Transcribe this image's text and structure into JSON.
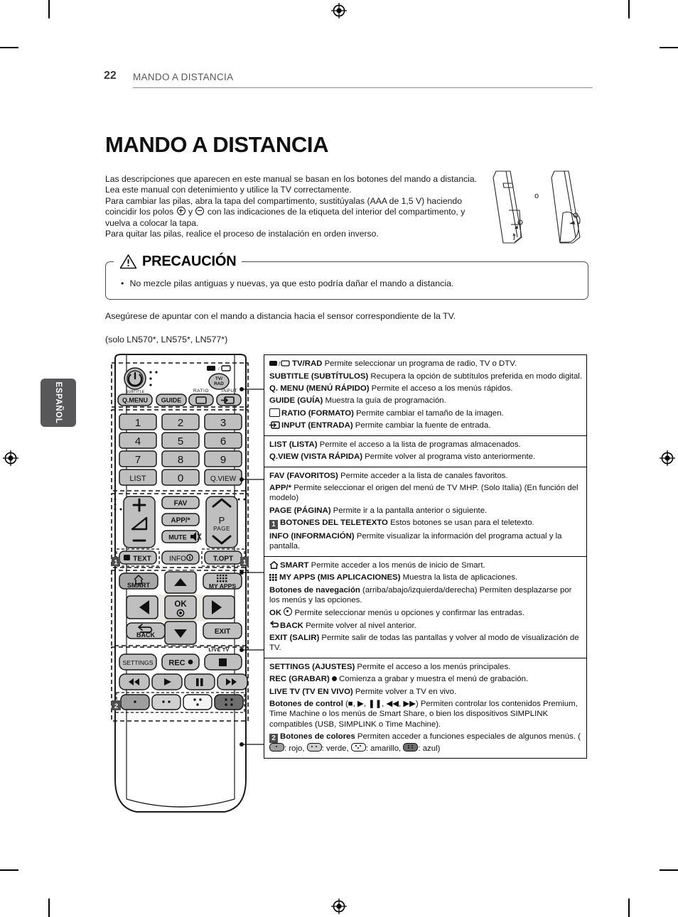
{
  "page": {
    "number": "22",
    "section": "MANDO A DISTANCIA",
    "title": "MANDO A DISTANCIA",
    "language_tab": "ESPAÑOL"
  },
  "intro": {
    "line1": "Las descripciones que aparecen en este manual se basan en los botones del mando a distancia.",
    "line2": "Lea este manual con detenimiento y utilice la TV correctamente.",
    "line3_a": "Para cambiar las pilas, abra la tapa del compartimento, sustitúyalas (AAA de 1,5 V) haciendo coincidir los polos",
    "line3_b": "y",
    "line3_c": "con las indicaciones de la etiqueta del interior del compartimento, y vuelva a colocar la tapa.",
    "line4": "Para quitar las pilas, realice el proceso de instalación en orden inverso."
  },
  "battery_illustration": {
    "separator_label": "o"
  },
  "caution": {
    "heading": "PRECAUCIÓN",
    "bullet": "•",
    "item": "No mezcle pilas antiguas y nuevas, ya que esto podría dañar el mando a distancia."
  },
  "aim_note": "Asegúrese de apuntar con el mando a distancia hacia el sensor correspondiente de la TV.",
  "model_line": "(solo  LN570*, LN575*, LN577*)",
  "remote": {
    "buttons": {
      "power": "power-icon",
      "tv_rad": "TV/\nRAD",
      "subtitle_label": "SUBTITLE",
      "q_menu": "Q.MENU",
      "guide": "GUIDE",
      "ratio_label": "RATIO",
      "input_label": "INPUT",
      "num_1": "1",
      "num_2": "2",
      "num_3": "3",
      "num_4": "4",
      "num_5": "5",
      "num_6": "6",
      "num_7": "7",
      "num_8": "8",
      "num_9": "9",
      "num_0": "0",
      "list": "LIST",
      "qview": "Q.VIEW",
      "fav": "FAV",
      "app": "APP/*",
      "mute": "MUTE",
      "page_p": "P",
      "page_label": "PAGE",
      "text": "TEXT",
      "info": "INFO",
      "t_opt": "T.OPT",
      "smart": "SMART",
      "my_apps": "MY APPS",
      "ok": "OK",
      "back": "BACK",
      "exit": "EXIT",
      "live_tv": "LIVE TV",
      "settings": "SETTINGS",
      "rec": "REC",
      "badge_1": "1",
      "badge_2": "2"
    }
  },
  "descriptions": [
    {
      "rows": [
        {
          "icon": "tvrad-icon",
          "lead": "TV/RAD",
          "text": "Permite seleccionar un programa de radio, TV o DTV."
        },
        {
          "lead": "SUBTITLE (SUBTÍTULOS)",
          "text": "Recupera la opción de subtítulos preferida en modo digital."
        },
        {
          "lead": "Q. MENU (MENÚ RÁPIDO)",
          "text": "Permite el acceso a los menús rápidos."
        },
        {
          "lead": "GUIDE (GUÍA)",
          "text": "Muestra la guía de programación."
        },
        {
          "icon": "ratio-icon",
          "lead": "RATIO (FORMATO)",
          "text": "Permite cambiar el tamaño de la imagen."
        },
        {
          "icon": "input-icon",
          "lead": "INPUT (ENTRADA)",
          "text": "Permite cambiar la fuente de entrada."
        }
      ]
    },
    {
      "rows": [
        {
          "lead": "LIST (LISTA)",
          "text": "Permite el acceso a la lista de programas almacenados."
        },
        {
          "lead": "Q.VIEW (VISTA RÁPIDA)",
          "text": "Permite volver al programa visto anteriormente."
        }
      ]
    },
    {
      "rows": [
        {
          "lead": "FAV (FAVORITOS)",
          "text": "Permite acceder a la lista de canales favoritos."
        },
        {
          "lead": "APP/*",
          "text": "Permite seleccionar el origen del menú de TV MHP. (Solo Italia) (En función del modelo)"
        },
        {
          "lead": "PAGE (PÁGINA)",
          "text": "Permite ir a la pantalla anterior o siguiente."
        },
        {
          "badge": "1",
          "lead": "BOTONES DEL TELETEXTO",
          "text": "Estos botones se usan para el teletexto."
        },
        {
          "lead": "INFO (INFORMACIÓN)",
          "text": "Permite visualizar la información del programa actual y la pantalla."
        }
      ]
    },
    {
      "rows": [
        {
          "icon": "home-icon",
          "lead": "SMART",
          "text": "Permite acceder a los menús de inicio de Smart."
        },
        {
          "icon": "apps-icon",
          "lead": "MY APPS (MIS APLICACIONES)",
          "text": "Muestra la lista de aplicaciones."
        },
        {
          "lead": "Botones de navegación",
          "text": "(arriba/abajo/izquierda/derecha) Permiten desplazarse por los menús y las opciones."
        },
        {
          "lead": "OK",
          "icon_after": "ok-icon",
          "text": "Permite seleccionar menús u opciones y confirmar las entradas."
        },
        {
          "icon": "back-icon",
          "lead": "BACK",
          "text": "Permite volver al nivel anterior."
        },
        {
          "lead": "EXIT (SALIR)",
          "text": " Permite salir de todas las pantallas y volver al modo de visualización de TV."
        }
      ]
    },
    {
      "rows": [
        {
          "lead": "SETTINGS (AJUSTES)",
          "text": "Permite el acceso a los menús principales."
        },
        {
          "lead": "REC (GRABAR)",
          "icon_after": "rec-dot-icon",
          "text": "Comienza a grabar y muestra el menú de grabación."
        },
        {
          "lead": "LIVE TV (TV EN VIVO)",
          "text": "Permite volver a TV en vivo."
        },
        {
          "lead": "Botones de control",
          "text": "(■, ▶, ❚❚, ◀◀, ▶▶) Permiten controlar los contenidos Premium, Time Machine o los menús de Smart Share, o bien los dispositivos SIMPLINK compatibles (USB, SIMPLINK o Time Machine)."
        },
        {
          "badge": "2",
          "lead": "Botones de colores",
          "text": "Permiten acceder a funciones especiales de algunos menús.",
          "colors": ": rojo,  : verde,  : amarillo,  : azul)"
        }
      ]
    }
  ],
  "color_legend": {
    "open_paren": "(",
    "red": ": rojo,",
    "green": ": verde,",
    "yellow": ": amarillo,",
    "blue": ": azul)"
  }
}
